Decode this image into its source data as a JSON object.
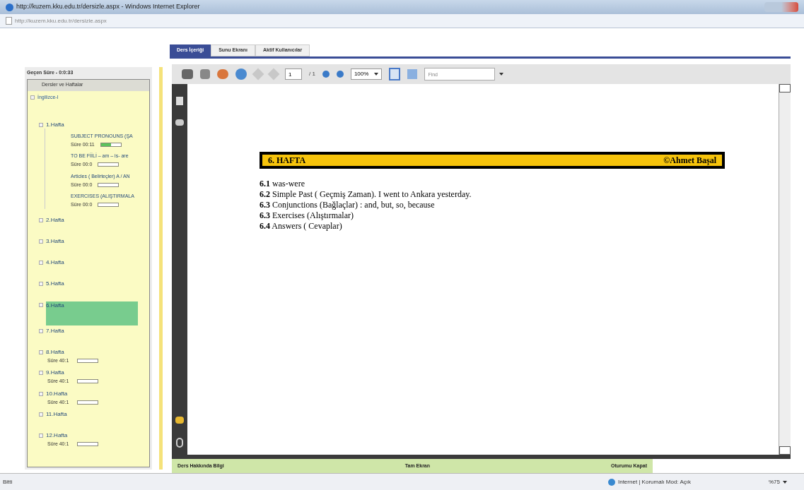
{
  "window": {
    "title": "http://kuzem.kku.edu.tr/dersizle.aspx - Windows Internet Explorer"
  },
  "address_bar": {
    "value": "http://kuzem.kku.edu.tr/dersizle.aspx"
  },
  "sidebar": {
    "timer": "Geçen Süre - 0:0:33",
    "header": "Dersler ve Haftalar",
    "tree": [
      {
        "label": "İngilizce-I",
        "children": [
          {
            "label": "1.Hafta",
            "selected": false,
            "children": [
              {
                "label": "SUBJECT PRONOUNS (ŞA",
                "time": "Süre 00:11",
                "level": 0.5
              },
              {
                "label": "TO BE FİİLİ – am – is- are",
                "time": "Süre 00:0",
                "level": 0
              },
              {
                "label": "Articles ( Belirteçler) A / AN",
                "time": "Süre 00:0",
                "level": 0
              },
              {
                "label": "EXERCISES (ALIŞTIRMALA",
                "time": "Süre 00:0",
                "level": 0
              }
            ]
          },
          {
            "label": "2.Hafta",
            "selected": false
          },
          {
            "label": "3.Hafta",
            "selected": false
          },
          {
            "label": "4.Hafta",
            "selected": false
          },
          {
            "label": "5.Hafta",
            "selected": false
          },
          {
            "label": "6.Hafta",
            "selected": true
          },
          {
            "label": "7.Hafta",
            "selected": false
          },
          {
            "label": "8.Hafta",
            "selected": false,
            "time": "Süre 40:1",
            "level": 0
          },
          {
            "label": "9.Hafta",
            "selected": false,
            "time": "Süre 40:1",
            "level": 0
          },
          {
            "label": "10.Hafta",
            "selected": false,
            "time": "Süre 40:1",
            "level": 0
          },
          {
            "label": "11.Hafta",
            "selected": false
          },
          {
            "label": "12.Hafta",
            "selected": false,
            "time": "Süre 40:1",
            "level": 0
          }
        ]
      }
    ]
  },
  "tabs": [
    {
      "label": "Ders İçeriği",
      "selected": true
    },
    {
      "label": "Sunu Ekranı",
      "selected": false
    },
    {
      "label": "Aktif Kullanıcılar",
      "selected": false
    }
  ],
  "toolbar": {
    "page": "1",
    "page_count": "/ 1",
    "zoom": "100%",
    "find_placeholder": "Find"
  },
  "document": {
    "banner_title": "6. HAFTA",
    "banner_author": "©Ahmet Başal",
    "lines": [
      {
        "number": "6.1",
        "text": "was-were"
      },
      {
        "number": "6.2",
        "text": "Simple Past ( Geçmiş Zaman). I went to Ankara yesterday."
      },
      {
        "number": "6.3",
        "text": "Conjunctions (Bağlaçlar) : and, but, so, because"
      },
      {
        "number": "6.3",
        "text": "Exercises (Alıştırmalar)"
      },
      {
        "number": "6.4",
        "text": "Answers ( Cevaplar)"
      }
    ]
  },
  "bottom_links": [
    {
      "label": "Ders Hakkında Bilgi",
      "disabled": false
    },
    {
      "label": "Tam Ekran",
      "disabled": false
    },
    {
      "label": "Oturumu Kapat",
      "disabled": false
    }
  ],
  "status_bar": {
    "left": "Bitti",
    "zone": "Internet | Korumalı Mod: Açık",
    "zoom": "%75"
  }
}
